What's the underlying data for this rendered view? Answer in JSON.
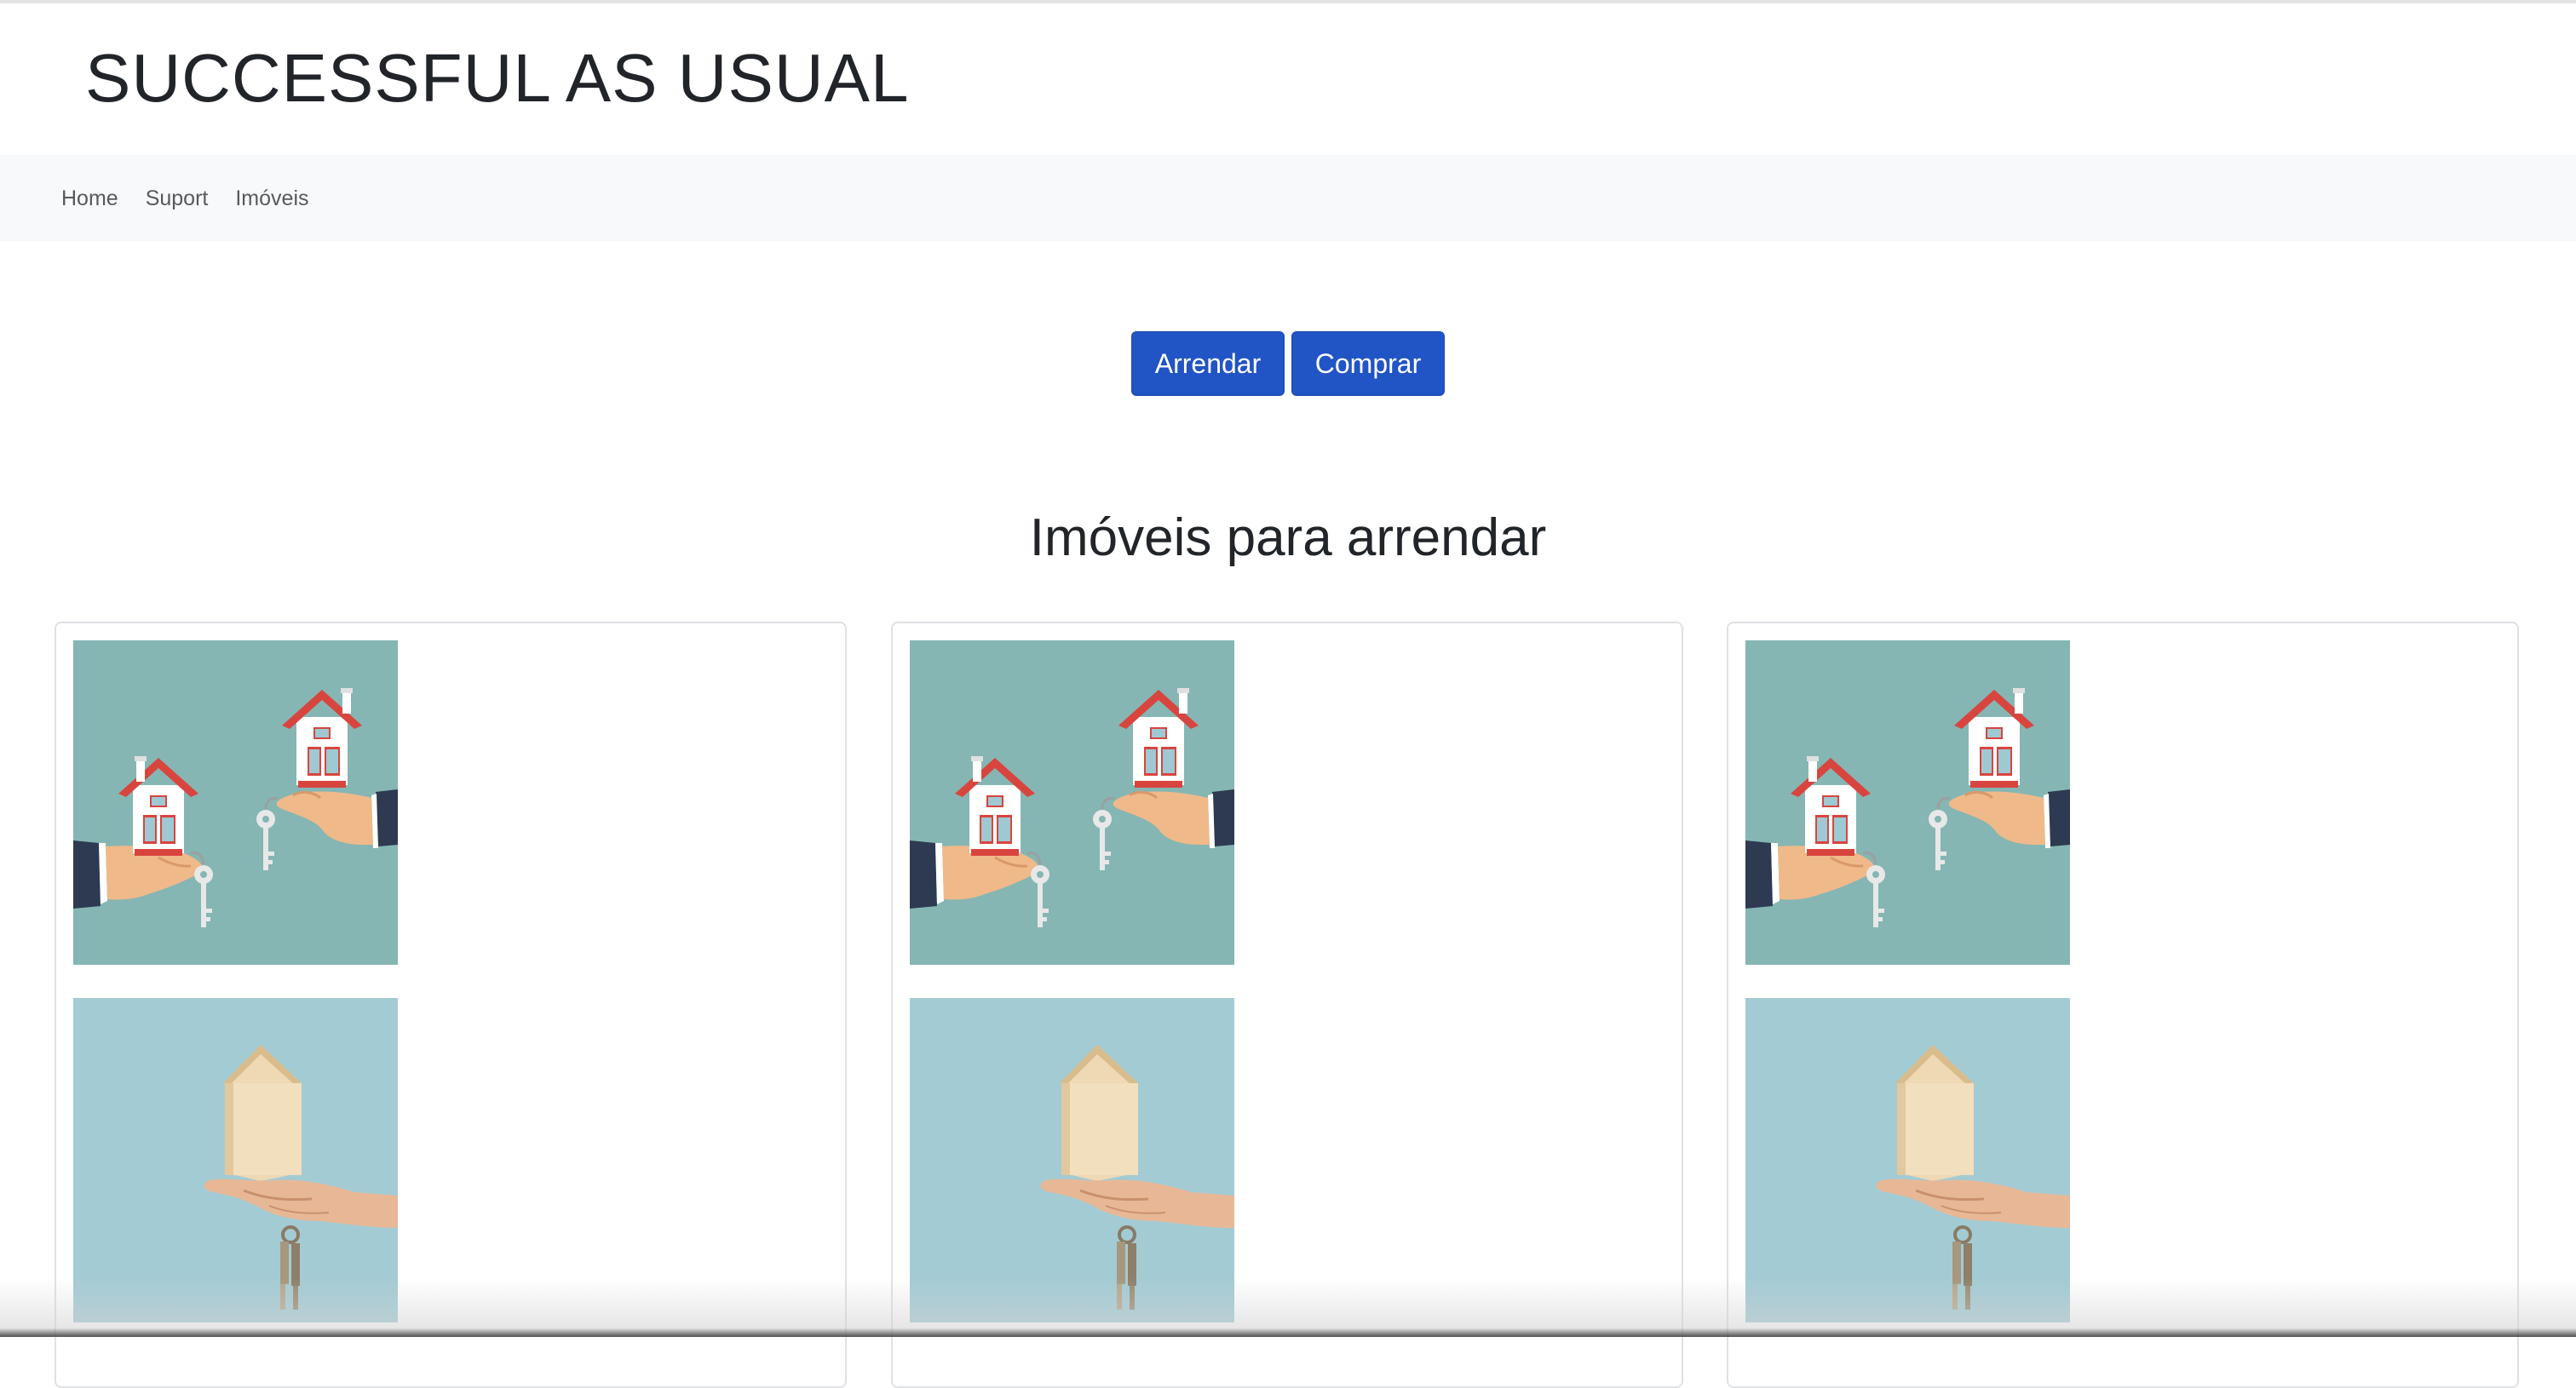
{
  "header": {
    "title": "SUCCESSFUL AS USUAL"
  },
  "nav": {
    "items": [
      {
        "label": "Home"
      },
      {
        "label": "Suport"
      },
      {
        "label": "Imóveis"
      }
    ]
  },
  "actions": {
    "arrendar_label": "Arrendar",
    "comprar_label": "Comprar"
  },
  "section": {
    "title": "Imóveis para arrendar"
  },
  "colors": {
    "accent": "#2154c4",
    "navbar_bg": "#f8f9fa",
    "image1_bg": "#85b6b3",
    "image2_bg": "#a3cbd4"
  },
  "listings": [
    {
      "images": [
        "houses-in-hands-illustration",
        "wooden-house-with-keys-photo"
      ]
    },
    {
      "images": [
        "houses-in-hands-illustration",
        "wooden-house-with-keys-photo"
      ]
    },
    {
      "images": [
        "houses-in-hands-illustration",
        "wooden-house-with-keys-photo"
      ]
    }
  ]
}
